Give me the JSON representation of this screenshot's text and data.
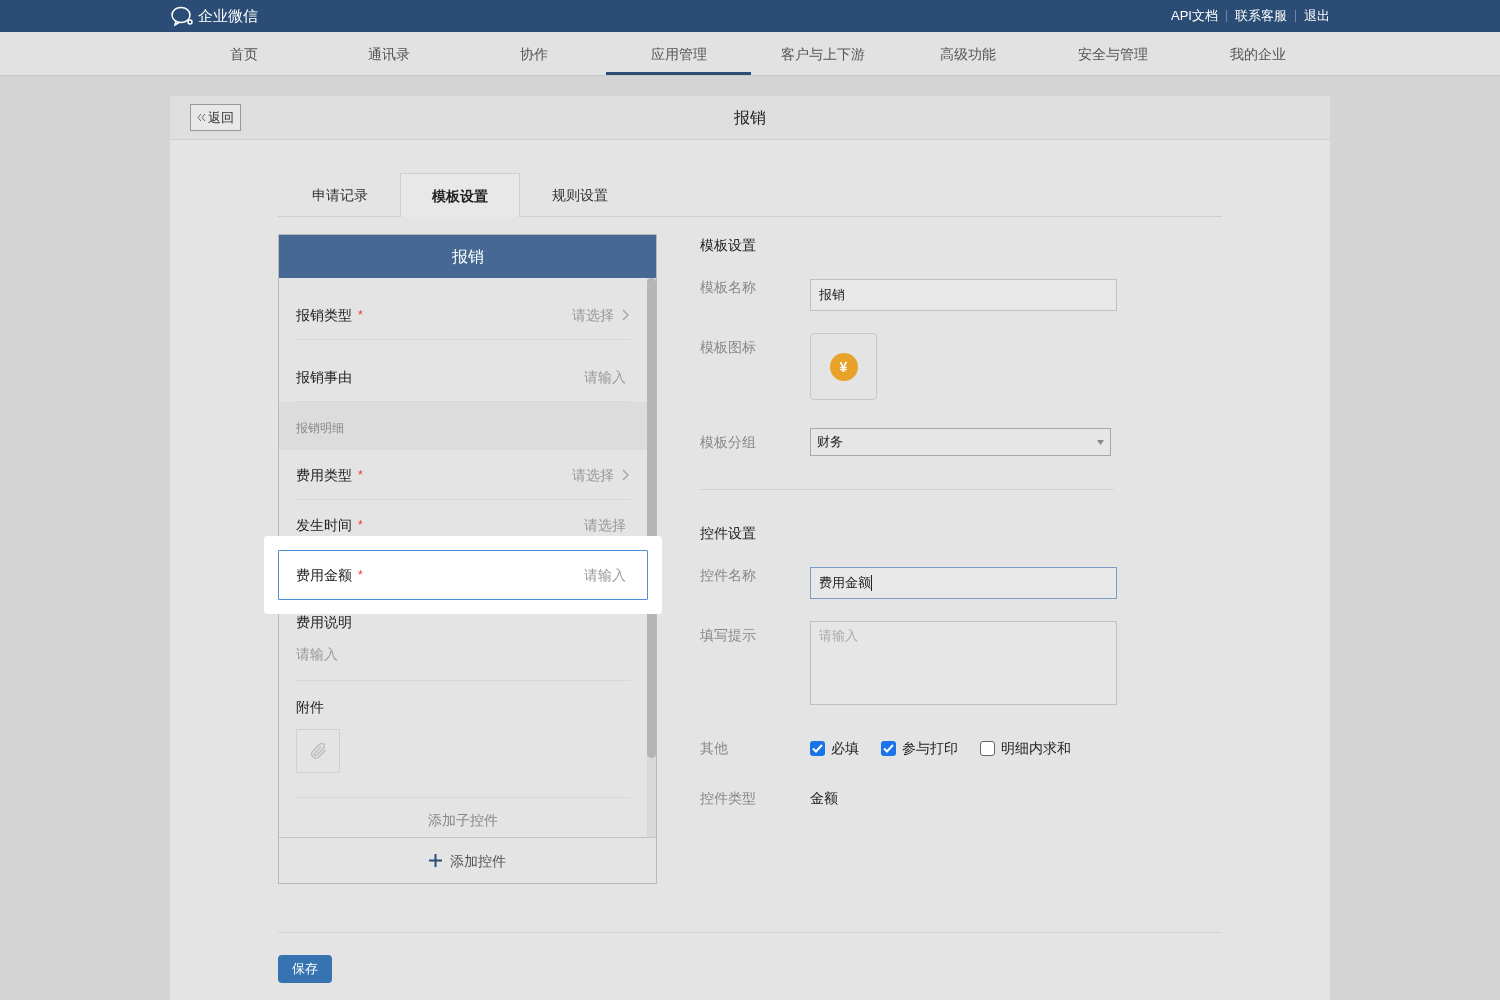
{
  "top_bar": {
    "logo": "企业微信",
    "links": [
      "API文档",
      "联系客服",
      "退出"
    ]
  },
  "nav": [
    {
      "label": "首页",
      "selected": false
    },
    {
      "label": "通讯录",
      "selected": false
    },
    {
      "label": "协作",
      "selected": false
    },
    {
      "label": "应用管理",
      "selected": true
    },
    {
      "label": "客户与上下游",
      "selected": false
    },
    {
      "label": "高级功能",
      "selected": false
    },
    {
      "label": "安全与管理",
      "selected": false
    },
    {
      "label": "我的企业",
      "selected": false
    }
  ],
  "page": {
    "back": "返回",
    "title": "报销"
  },
  "tabs": [
    {
      "label": "申请记录",
      "selected": false
    },
    {
      "label": "模板设置",
      "selected": true
    },
    {
      "label": "规则设置",
      "selected": false
    }
  ],
  "phone": {
    "title": "报销",
    "groups": [
      {
        "items": [
          {
            "kind": "field",
            "label": "报销类型",
            "required_mark": "*",
            "hint": "请选择",
            "chevron": true,
            "selected": false
          }
        ]
      },
      {
        "items": [
          {
            "kind": "field",
            "label": "报销事由",
            "hint": "请输入",
            "chevron": false,
            "selected": false
          }
        ]
      },
      {
        "section": "报销明细",
        "items": [
          {
            "kind": "field",
            "label": "费用类型",
            "required_mark": "*",
            "hint": "请选择",
            "chevron": true,
            "selected": false
          },
          {
            "kind": "field",
            "label": "发生时间",
            "required_mark": "*",
            "hint": "请选择",
            "chevron": false,
            "selected": false
          },
          {
            "kind": "field",
            "label": "费用金额",
            "required_mark": "*",
            "hint": "请输入",
            "chevron": false,
            "selected": true
          },
          {
            "kind": "textarea",
            "label": "费用说明",
            "hint": "请输入"
          },
          {
            "kind": "attachment",
            "label": "附件"
          },
          {
            "kind": "add_sub",
            "label": "添加子控件"
          }
        ]
      }
    ],
    "add": "添加控件"
  },
  "template": {
    "heading": "模板设置",
    "name_label": "模板名称",
    "name_value": "报销",
    "icon_label": "模板图标",
    "icon_glyph": "¥",
    "group_label": "模板分组",
    "group_value": "财务"
  },
  "control": {
    "heading": "控件设置",
    "name_label": "控件名称",
    "name_value": "费用金额",
    "hint_label": "填写提示",
    "hint_placeholder": "请输入",
    "other_label": "其他",
    "options": [
      {
        "label": "必填",
        "checked": true
      },
      {
        "label": "参与打印",
        "checked": true
      },
      {
        "label": "明细内求和",
        "checked": false
      }
    ],
    "type_label": "控件类型",
    "type_value": "金额"
  },
  "save": "保存"
}
